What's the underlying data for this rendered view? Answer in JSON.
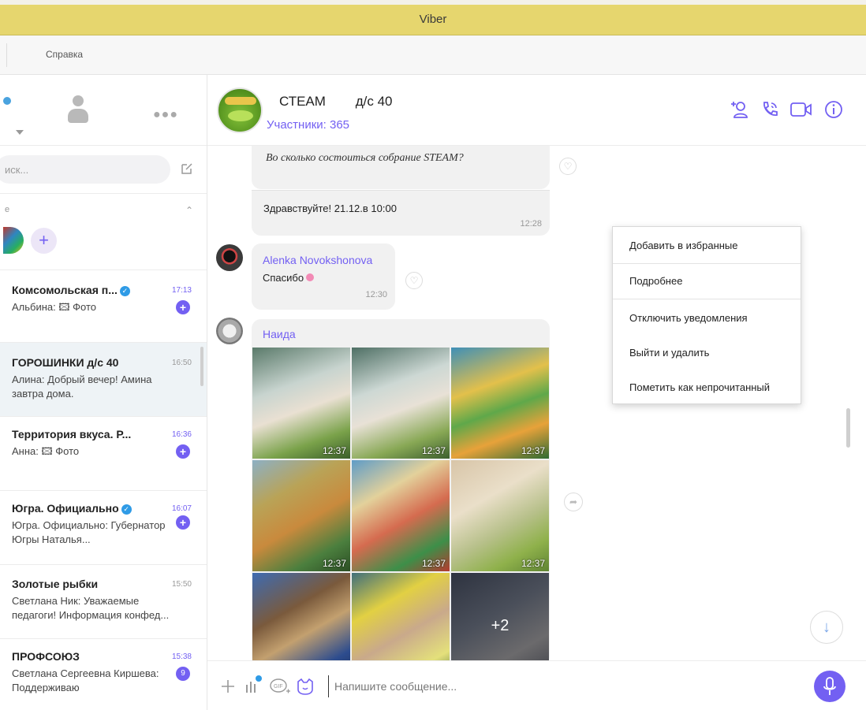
{
  "window": {
    "title": "Viber"
  },
  "menubar": {
    "help": "Справка"
  },
  "sidebar": {
    "search_placeholder": "иск...",
    "favorites_title": "е",
    "chats": [
      {
        "name": "Комсомольская п...",
        "preview": "Альбина: 🖾 Фото",
        "time": "17:13",
        "badge": "+",
        "verified": true
      },
      {
        "name": "ГОРОШИНКИ д/с 40",
        "preview": "Алина: Добрый вечер! Амина завтра дома.",
        "time": "16:50",
        "badge": "",
        "verified": false
      },
      {
        "name": "Территория вкуса. Р...",
        "preview": "Анна: 🖾 Фото",
        "time": "16:36",
        "badge": "+",
        "verified": false
      },
      {
        "name": "Югра. Официально",
        "preview": "Югра. Официально: Губернатор Югры Наталья...",
        "time": "16:07",
        "badge": "+",
        "verified": true
      },
      {
        "name": "Золотые рыбки",
        "preview": "Светлана Ник: Уважаемые педагоги! Информация конфед...",
        "time": "15:50",
        "badge": "",
        "verified": false
      },
      {
        "name": "ПРОФСОЮЗ",
        "preview": "Светлана Сергеевна Киршева: Поддерживаю",
        "time": "15:38",
        "badge": "9",
        "verified": false
      }
    ]
  },
  "chat": {
    "title": "СТЕАМ        д/с 40",
    "subtitle": "Участники: 365",
    "quoted_message": "Во сколько состоиться собрание STEAM?",
    "reply_text": "Здравствуйте! 21.12.в 10:00",
    "reply_time": "12:28",
    "alenka": {
      "name": "Alenka Novokshonova",
      "text": "Спасибо",
      "time": "12:30"
    },
    "naida": {
      "name": "Наида",
      "photos": [
        {
          "time": "12:37",
          "more": ""
        },
        {
          "time": "12:37",
          "more": ""
        },
        {
          "time": "12:37",
          "more": ""
        },
        {
          "time": "12:37",
          "more": ""
        },
        {
          "time": "12:37",
          "more": ""
        },
        {
          "time": "12:37",
          "more": ""
        },
        {
          "time": "",
          "more": ""
        },
        {
          "time": "",
          "more": ""
        },
        {
          "time": "",
          "more": "+2"
        }
      ]
    }
  },
  "composer": {
    "placeholder": "Напишите сообщение..."
  },
  "context_menu": {
    "items": [
      "Добавить в избранные",
      "Подробнее",
      "Отключить уведомления",
      "Выйти и удалить",
      "Пометить как непрочитанный"
    ]
  },
  "colors": {
    "titlebar": "#e6d66e",
    "accent": "#7360f2",
    "verified": "#2f9be6"
  }
}
